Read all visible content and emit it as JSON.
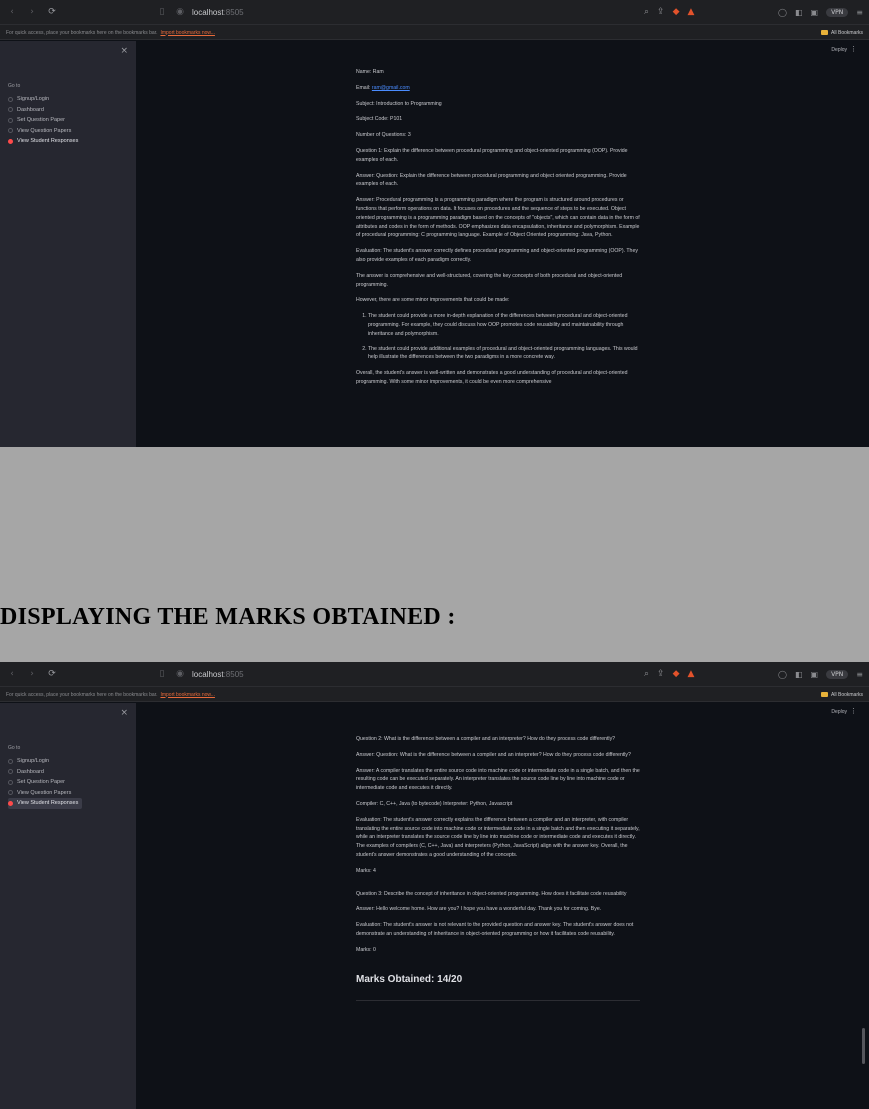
{
  "browser": {
    "url_host": "localhost",
    "url_port": ":8505",
    "vpn_label": "VPN",
    "bookmarks_bar_text": "For quick access, place your bookmarks here on the bookmarks bar.",
    "bookmarks_import_link": "Import bookmarks now...",
    "all_bookmarks_label": "All Bookmarks"
  },
  "app": {
    "deploy_label": "Deploy",
    "sidebar": {
      "close_icon": "close-icon",
      "goto_label": "Go to",
      "items": [
        {
          "label": "Signup/Login"
        },
        {
          "label": "Dashboard"
        },
        {
          "label": "Set Question Paper"
        },
        {
          "label": "View Question Papers"
        },
        {
          "label": "View Student Responses",
          "selected": true
        }
      ]
    }
  },
  "screen1": {
    "name": "Name: Ram",
    "email_label": "Email: ",
    "email_value": "ram@gmail.com",
    "subject": "Subject: Introduction to Programming",
    "subject_code": "Subject Code: P101",
    "num_questions": "Number of Questions: 3",
    "q1": "Question 1: Explain the difference between procedural programming and object-oriented programming (OOP). Provide examples of each.",
    "a1_question": "Answer: Question: Explain the difference between procedural programming and object oriented programming. Provide examples of each.",
    "a1_answer": "Answer: Procedural programming is a programming paradigm where the program is structured around procedures or functions that perform operations on data. It focuses on procedures and the sequence of steps to be executed. Object oriented programming is a programming paradigm based on the concepts of \"objects\", which can contain data in the form of attributes and codes in the form of methods. OOP emphasizes data encapsulation, inheritance and polymorphism. Example of procedural programming: C programming language. Example of Object Oriented programming: Java, Python.",
    "eval1": "Evaluation: The student's answer correctly defines procedural programming and object-oriented programming (OOP). They also provide examples of each paradigm correctly.",
    "eval1_b": "The answer is comprehensive and well-structured, covering the key concepts of both procedural and object-oriented programming.",
    "eval1_c": "However, there are some minor improvements that could be made:",
    "improvements": [
      "The student could provide a more in-depth explanation of the differences between procedural and object-oriented programming. For example, they could discuss how OOP promotes code reusability and maintainability through inheritance and polymorphism.",
      "The student could provide additional examples of procedural and object-oriented programming languages. This would help illustrate the differences between the two paradigms in a more concrete way."
    ],
    "overall": "Overall, the student's answer is well-written and demonstrates a good understanding of procedural and object-oriented programming. With some minor improvements, it could be even more comprehensive"
  },
  "caption": "DISPLAYING THE MARKS OBTAINED :",
  "screen2": {
    "q2": "Question 2: What is the difference between a compiler and an interpreter? How do they process code differently?",
    "a2_question": "Answer: Question: What is the difference between a compiler and an interpreter? How do they process code differently?",
    "a2_answer": "Answer: A compiler translates the entire source code into machine code or intermediate code in a single batch, and then the resulting code can be executed separately. An interpreter translates the source code line by line into machine code or intermediate code and executes it directly.",
    "a2_examples": "Compiler: C, C++, Java (to bytecode) Interpreter: Python, Javascript",
    "eval2": "Evaluation: The student's answer correctly explains the difference between a compiler and an interpreter, with compiler translating the entire source code into machine code or intermediate code in a single batch and then executing it separately, while an interpreter translates the source code line by line into machine code or intermediate code and executes it directly. The examples of compilers (C, C++, Java) and interpreters (Python, JavaScript) align with the answer key. Overall, the student's answer demonstrates a good understanding of the concepts.",
    "marks2": "Marks: 4",
    "q3": "Question 3: Describe the concept of inheritance in object-oriented programming. How does it facilitate code reusability",
    "a3": "Answer: Hello welcome home. How are you? I hope you have a wonderful day. Thank you for coming. Bye.",
    "eval3": "Evaluation: The student's answer is not relevant to the provided question and answer key. The student's answer does not demonstrate an understanding of inheritance in object-oriented programming or how it facilitates code reusability.",
    "marks3": "Marks: 0",
    "marks_obtained": "Marks Obtained: 14/20"
  }
}
